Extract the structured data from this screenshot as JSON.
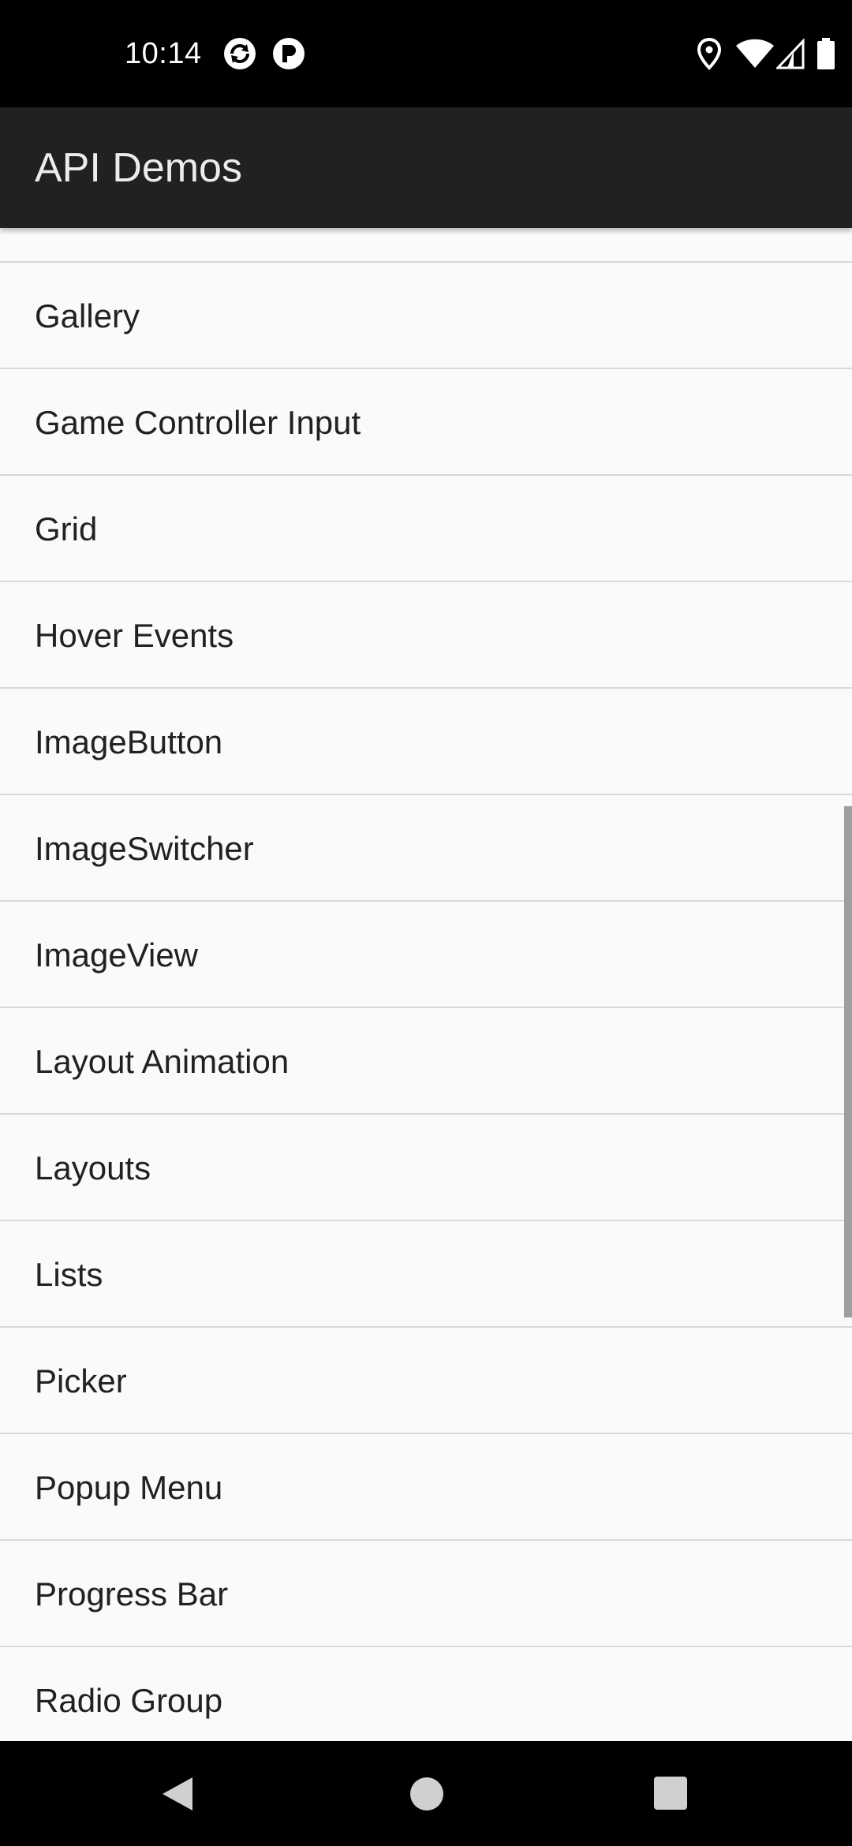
{
  "status_bar": {
    "time": "10:14",
    "left_icons": [
      "sync-icon",
      "notification-app-icon"
    ],
    "right_icons": [
      "location-icon",
      "wifi-icon",
      "cell-signal-icon",
      "battery-icon"
    ]
  },
  "app_bar": {
    "title": "API Demos"
  },
  "list": {
    "items": [
      {
        "label": "Gallery"
      },
      {
        "label": "Game Controller Input"
      },
      {
        "label": "Grid"
      },
      {
        "label": "Hover Events"
      },
      {
        "label": "ImageButton"
      },
      {
        "label": "ImageSwitcher"
      },
      {
        "label": "ImageView"
      },
      {
        "label": "Layout Animation"
      },
      {
        "label": "Layouts"
      },
      {
        "label": "Lists"
      },
      {
        "label": "Picker"
      },
      {
        "label": "Popup Menu"
      },
      {
        "label": "Progress Bar"
      },
      {
        "label": "Radio Group"
      }
    ]
  },
  "nav_bar": {
    "buttons": [
      "back-icon",
      "home-icon",
      "recents-icon"
    ]
  },
  "colors": {
    "status_bar": "#000000",
    "app_bar": "#212121",
    "title_text": "#ececec",
    "list_background": "#fafafa",
    "divider": "#d9d9d9",
    "item_text": "#212121",
    "nav_icons": "#d0d0d0"
  }
}
